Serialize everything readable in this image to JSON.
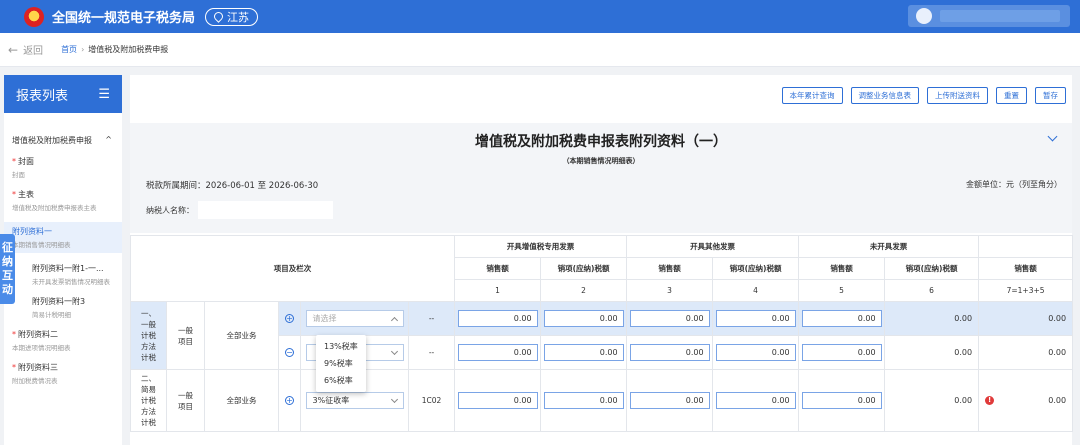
{
  "topbar": {
    "site_title": "全国统一规范电子税务局",
    "region": "江苏"
  },
  "crumbbar": {
    "back_label": "返回",
    "crumb_home": "首页",
    "crumb_current": "增值税及附加税费申报"
  },
  "sidebar": {
    "title": "报表列表",
    "group_label": "增值税及附加税费申报",
    "items": [
      {
        "title": "封面",
        "subtitle": "封面",
        "required": true
      },
      {
        "title": "主表",
        "subtitle": "增值税及附加税费申报表主表",
        "required": true
      },
      {
        "title": "附列资料一",
        "subtitle": "本期销售情况明细表",
        "required": false
      },
      {
        "title": "附列资料一附1-一...",
        "subtitle": "未开具发票销售情况明细表",
        "required": false
      },
      {
        "title": "附列资料一附3",
        "subtitle": "简易计税明细",
        "required": false
      },
      {
        "title": "附列资料二",
        "subtitle": "本期进项情况明细表",
        "required": true
      },
      {
        "title": "附列资料三",
        "subtitle": "附加税费情况表",
        "required": true
      }
    ],
    "float_tab": "征纳互动"
  },
  "actions": [
    "本年累计查询",
    "调整业务信息表",
    "上传附送资料",
    "重置",
    "暂存"
  ],
  "form": {
    "title": "增值税及附加税费申报表附列资料（一）",
    "subtitle": "（本期销售情况明细表）",
    "period": "税款所属期间：2026-06-01 至 2026-06-30",
    "unit": "金额单位：元（列至角分）",
    "taxpayer_label": "纳税人名称："
  },
  "table": {
    "item_col": "项目及栏次",
    "groups": [
      "开具增值税专用发票",
      "开具其他发票",
      "未开具发票"
    ],
    "sub_headers": [
      "销售额",
      "销项(应纳)税额",
      "销售额",
      "销项(应纳)税额",
      "销售额",
      "销项(应纳)税额",
      "销售额"
    ],
    "col_numbers": [
      "1",
      "2",
      "3",
      "4",
      "5",
      "6",
      "7=1+3+5"
    ],
    "row1": {
      "cat": "一、一般计税方法计税",
      "type": "一般项目",
      "biz": "全部业务",
      "select_placeholder": "请选择",
      "code": "--",
      "values": [
        "0.00",
        "0.00",
        "0.00",
        "0.00",
        "0.00",
        "0.00",
        "0.00"
      ]
    },
    "row2": {
      "code": "--",
      "values": [
        "0.00",
        "0.00",
        "0.00",
        "0.00",
        "0.00",
        "0.00",
        "0.00"
      ]
    },
    "row3": {
      "cat": "二、简易计税方法计税",
      "type": "一般项目",
      "biz": "全部业务",
      "select_value": "3%征收率",
      "code": "1C02",
      "values": [
        "0.00",
        "0.00",
        "0.00",
        "0.00",
        "0.00",
        "0.00",
        "0.00"
      ]
    }
  },
  "dropdown": [
    "13%税率",
    "9%税率",
    "6%税率"
  ]
}
